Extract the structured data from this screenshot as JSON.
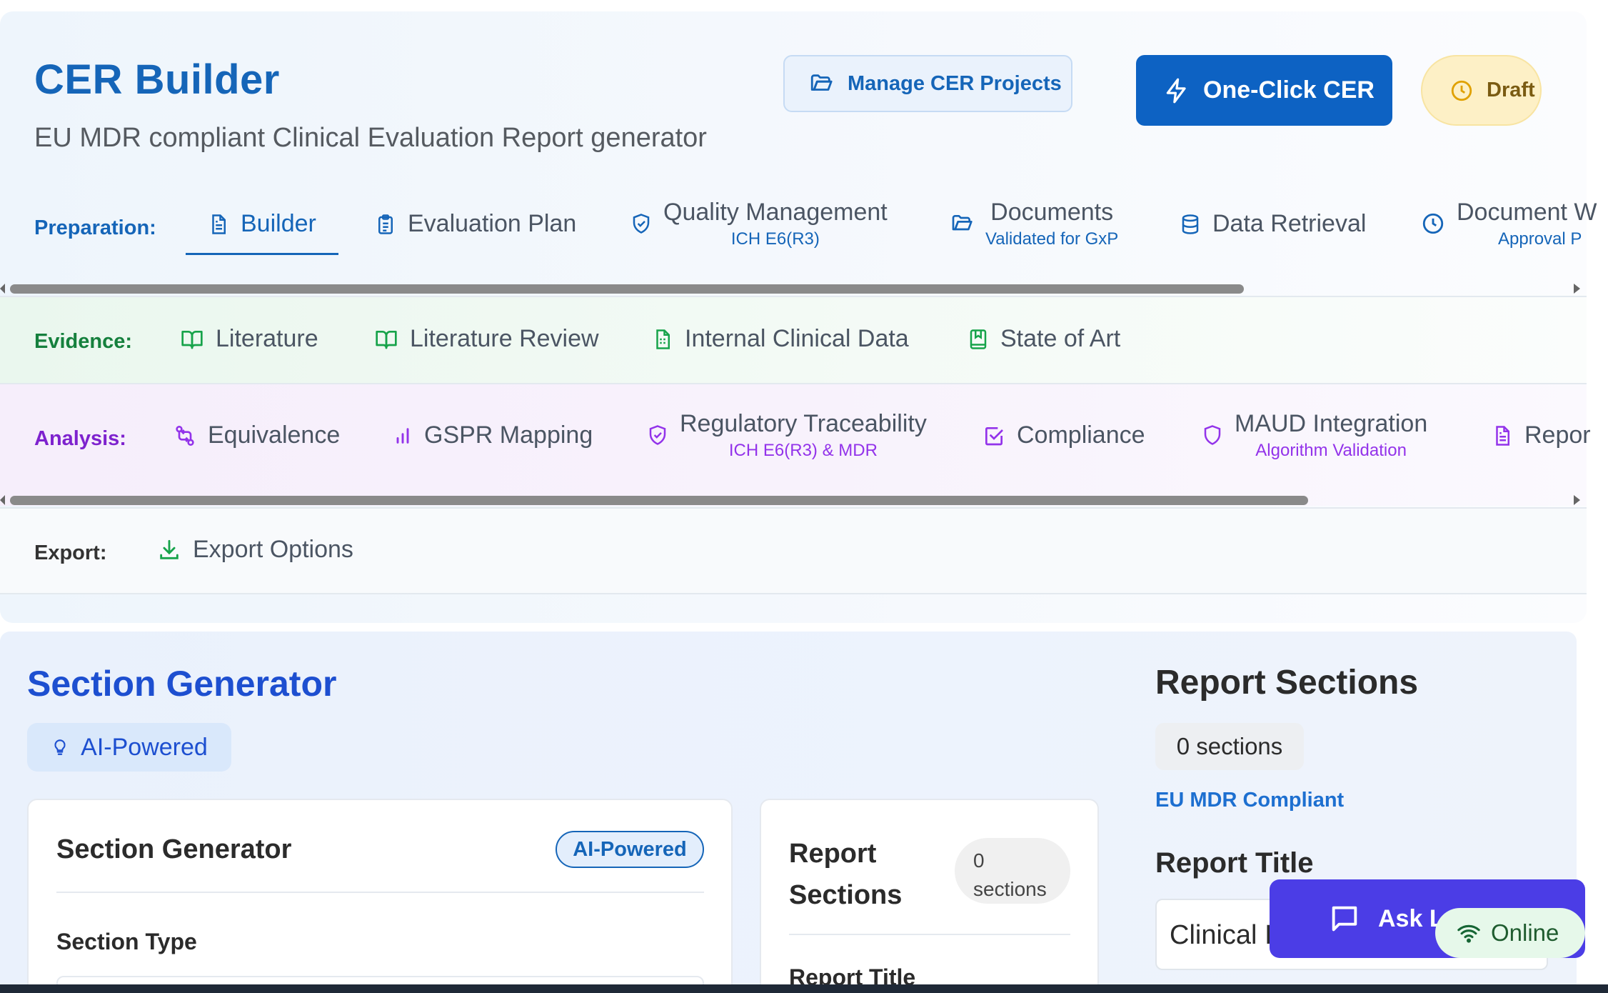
{
  "header": {
    "title": "CER Builder",
    "subtitle": "EU MDR compliant Clinical Evaluation Report generator",
    "manage_label": "Manage CER Projects",
    "oneclick_label": "One-Click CER",
    "status_label": "Draft"
  },
  "colors": {
    "primary": "#1565b8",
    "button_blue": "#0d62c3",
    "evidence_green": "#15803d",
    "analysis_purple": "#7e22ce",
    "draft_yellow": "#fdf0c6",
    "chat_indigo": "#4b3de6"
  },
  "preparation": {
    "label": "Preparation:",
    "tabs": [
      {
        "label": "Builder",
        "icon": "file-text-icon",
        "active": true
      },
      {
        "label": "Evaluation Plan",
        "icon": "clipboard-list-icon"
      },
      {
        "label": "Quality Management",
        "sub": "ICH E6(R3)",
        "icon": "shield-check-icon"
      },
      {
        "label": "Documents",
        "sub": "Validated for GxP",
        "icon": "folder-open-icon"
      },
      {
        "label": "Data Retrieval",
        "icon": "database-icon"
      },
      {
        "label": "Document W",
        "sub": "Approval P",
        "icon": "clock-icon"
      }
    ]
  },
  "evidence": {
    "label": "Evidence:",
    "tabs": [
      {
        "label": "Literature",
        "icon": "book-open-icon"
      },
      {
        "label": "Literature Review",
        "icon": "book-open-icon"
      },
      {
        "label": "Internal Clinical Data",
        "icon": "file-spreadsheet-icon"
      },
      {
        "label": "State of Art",
        "icon": "bookmark-book-icon"
      }
    ]
  },
  "analysis": {
    "label": "Analysis:",
    "tabs": [
      {
        "label": "Equivalence",
        "icon": "git-compare-icon"
      },
      {
        "label": "GSPR Mapping",
        "icon": "bar-chart-icon"
      },
      {
        "label": "Regulatory Traceability",
        "sub": "ICH E6(R3) & MDR",
        "icon": "shield-check-icon"
      },
      {
        "label": "Compliance",
        "icon": "check-square-icon"
      },
      {
        "label": "MAUD Integration",
        "sub": "Algorithm Validation",
        "icon": "shield-icon"
      },
      {
        "label": "Repor",
        "icon": "file-text-icon"
      }
    ]
  },
  "export": {
    "label": "Export:",
    "tabs": [
      {
        "label": "Export Options",
        "icon": "download-icon"
      }
    ]
  },
  "section_generator": {
    "title": "Section Generator",
    "badge": "AI-Powered",
    "card": {
      "title": "Section Generator",
      "badge": "AI-Powered",
      "field_label": "Section Type"
    }
  },
  "report_sections_card": {
    "title_line1": "Report",
    "title_line2": "Sections",
    "count_line1": "0",
    "count_line2": "sections",
    "next_label": "Report Title"
  },
  "report_sections_panel": {
    "title": "Report Sections",
    "count": "0 sections",
    "compliance_link": "EU MDR Compliant",
    "report_title_label": "Report Title",
    "report_title_value": "Clinical I"
  },
  "chat": {
    "label": "Ask Lu",
    "status": "Online"
  }
}
